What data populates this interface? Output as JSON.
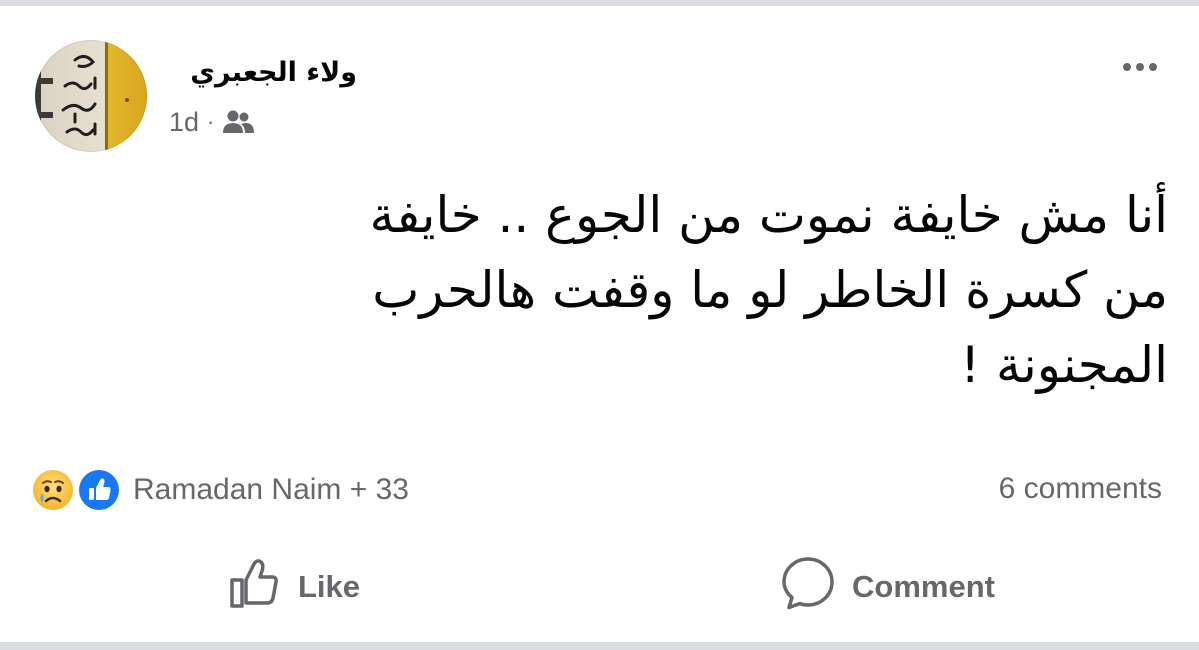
{
  "post": {
    "author": "ولاء الجعبري",
    "time": "1d",
    "separator": "·",
    "audience_icon": "friends-icon",
    "more_icon": "more-options-icon",
    "text": "أنا مش خايفة نموت من الجوع .. خايفة\nمن كسرة الخاطر لو ما وقفت هالحرب\nالمجنونة !"
  },
  "avatar": {
    "colors": {
      "wall": "#e6e0cf",
      "door": "#e3b82c"
    }
  },
  "reactions": {
    "icons": [
      "sad-reaction-icon",
      "like-reaction-icon"
    ],
    "summary": "Ramadan Naim + 33",
    "comments": "6 comments"
  },
  "actions": {
    "like_label": "Like",
    "comment_label": "Comment"
  },
  "colors": {
    "like_blue": "#1877f2",
    "text_secondary": "#65676b",
    "text_primary": "#050505",
    "divider": "#dadde1"
  }
}
